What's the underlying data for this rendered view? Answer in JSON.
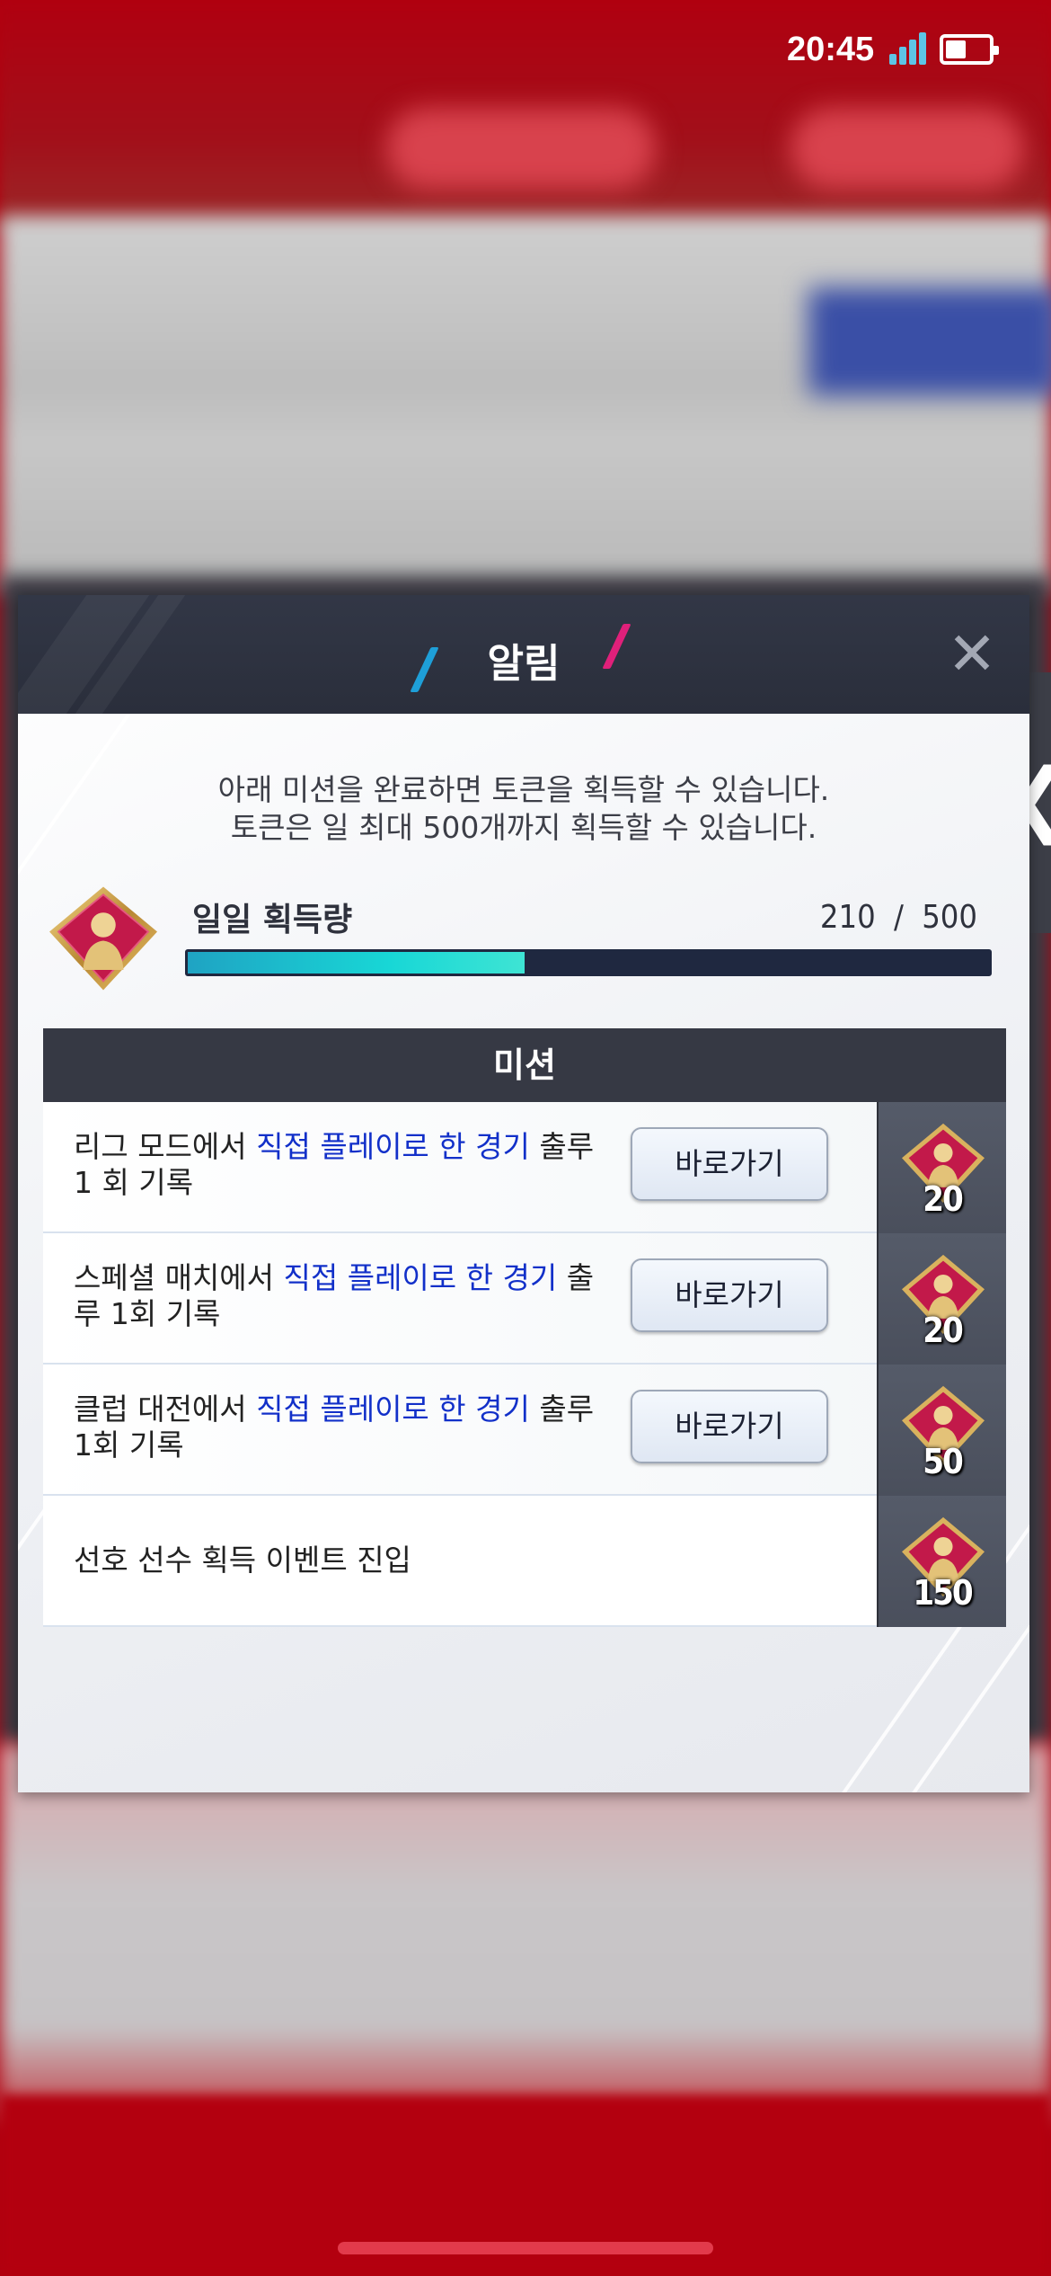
{
  "status_bar": {
    "time": "20:45"
  },
  "dialog": {
    "title": "알림",
    "close_icon": "close-icon",
    "description_line1": "아래 미션을 완료하면 토큰을 획득할 수 있습니다.",
    "description_line2": "토큰은 일 최대 500개까지 획득할 수 있습니다."
  },
  "daily": {
    "label": "일일 획득량",
    "current": "210",
    "separator": "/",
    "max": "500",
    "progress_fraction": 0.42
  },
  "missions": {
    "header": "미션",
    "items": [
      {
        "text_before": "리그 모드에서 ",
        "highlight": "직접 플레이로 한 경기",
        "text_after": " 출루 1 회 기록",
        "button": "바로가기",
        "reward": "20"
      },
      {
        "text_before": "스페셜 매치에서 ",
        "highlight": "직접 플레이로 한 경기",
        "text_after": " 출루 1회 기록",
        "button": "바로가기",
        "reward": "20"
      },
      {
        "text_before": "클럽 대전에서 ",
        "highlight": "직접 플레이로 한 경기",
        "text_after": " 출루 1회 기록",
        "button": "바로가기",
        "reward": "50"
      },
      {
        "text_before": "선호 선수 획득 이벤트 진입",
        "highlight": "",
        "text_after": "",
        "button": "",
        "reward": "150"
      }
    ]
  },
  "colors": {
    "accent_blue": "#1e9fd8",
    "accent_pink": "#e0207a",
    "highlight_text": "#1230c9",
    "progress_fill": "#18d7d6",
    "header_dark": "#2a2e3b"
  }
}
